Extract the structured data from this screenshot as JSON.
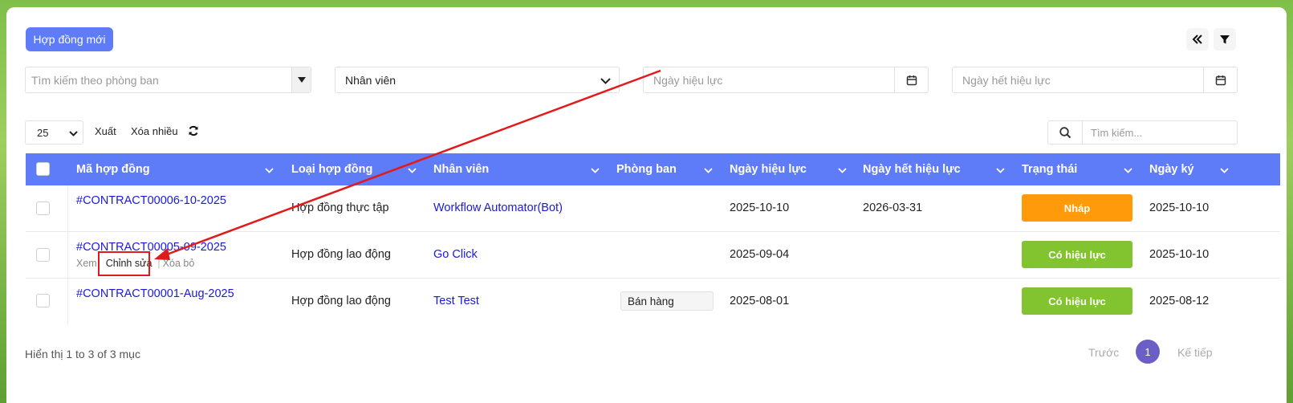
{
  "header": {
    "new_contract_label": "Hợp đồng mới"
  },
  "filters": {
    "department_placeholder": "Tìm kiếm theo phòng ban",
    "employee_selected": "Nhân viên",
    "effective_date_placeholder": "Ngày hiệu lực",
    "expiry_date_placeholder": "Ngày hết hiệu lực"
  },
  "toolbar": {
    "page_size": "25",
    "export_label": "Xuất",
    "bulk_delete_label": "Xóa nhiều",
    "search_placeholder": "Tìm kiếm..."
  },
  "table": {
    "columns": [
      "Mã hợp đồng",
      "Loại hợp đồng",
      "Nhân viên",
      "Phòng ban",
      "Ngày hiệu lực",
      "Ngày hết hiệu lực",
      "Trạng thái",
      "Ngày ký"
    ],
    "rows": [
      {
        "code": "#CONTRACT00006-10-2025",
        "type": "Hợp đồng thực tập",
        "employee": "Workflow Automator(Bot)",
        "department": "",
        "effective": "2025-10-10",
        "expiry": "2026-03-31",
        "status": "Nháp",
        "signed": "2025-10-10"
      },
      {
        "code": "#CONTRACT00005-09-2025",
        "type": "Hợp đồng lao động",
        "employee": "Go Click",
        "department": "",
        "effective": "2025-09-04",
        "expiry": "",
        "status": "Có hiệu lực",
        "signed": "2025-10-10"
      },
      {
        "code": "#CONTRACT00001-Aug-2025",
        "type": "Hợp đồng lao động",
        "employee": "Test Test",
        "department": "Bán hàng",
        "effective": "2025-08-01",
        "expiry": "",
        "status": "Có hiệu lực",
        "signed": "2025-08-12"
      }
    ],
    "row_actions": {
      "view": "Xem",
      "edit": "Chỉnh sửa",
      "remove": "Xóa bỏ"
    }
  },
  "footer": {
    "info": "Hiển thị 1 to 3 of 3 mục",
    "prev_label": "Trước",
    "current_page": "1",
    "next_label": "Kế tiếp"
  },
  "colors": {
    "accent": "#5f7cf8",
    "status_draft": "#ff9a0a",
    "status_active": "#82c42f",
    "annotation": "#e01b1b"
  }
}
